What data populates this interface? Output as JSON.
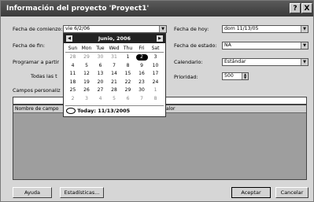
{
  "window": {
    "title": "Información del proyecto 'Proyect1'",
    "help_label": "?",
    "close_label": "X"
  },
  "labels": {
    "fecha_comienzo": "Fecha de comienzo:",
    "fecha_fin": "Fecha de fin:",
    "programar": "Programar a partir",
    "todas": "Todas las t",
    "campos": "Campos personaliz",
    "fecha_hoy": "Fecha de hoy:",
    "fecha_estado": "Fecha de estado:",
    "calendario": "Calendario:",
    "prioridad": "Prioridad:"
  },
  "fields": {
    "fecha_comienzo": "vie 6/2/06",
    "fecha_hoy": "dom 11/13/05",
    "fecha_estado": "NA",
    "calendario": "Estándar",
    "prioridad": "500"
  },
  "grid": {
    "col1": "Nombre de campo",
    "col2": "alor"
  },
  "calendar": {
    "month": "Junio, 2006",
    "days_of_week": [
      "Sun",
      "Mon",
      "Tue",
      "Wed",
      "Thu",
      "Fri",
      "Sat"
    ],
    "weeks": [
      [
        "28",
        "29",
        "30",
        "31",
        "1",
        "2",
        "3"
      ],
      [
        "4",
        "5",
        "6",
        "7",
        "8",
        "9",
        "10"
      ],
      [
        "11",
        "12",
        "13",
        "14",
        "15",
        "16",
        "17"
      ],
      [
        "18",
        "19",
        "20",
        "21",
        "22",
        "23",
        "24"
      ],
      [
        "25",
        "26",
        "27",
        "28",
        "29",
        "30",
        "1"
      ],
      [
        "2",
        "3",
        "4",
        "5",
        "6",
        "7",
        "8"
      ]
    ],
    "today_text": "Today: 11/13/2005"
  },
  "buttons": {
    "ayuda": "Ayuda",
    "estadisticas": "Estadísticas...",
    "aceptar": "Aceptar",
    "cancelar": "Cancelar"
  }
}
